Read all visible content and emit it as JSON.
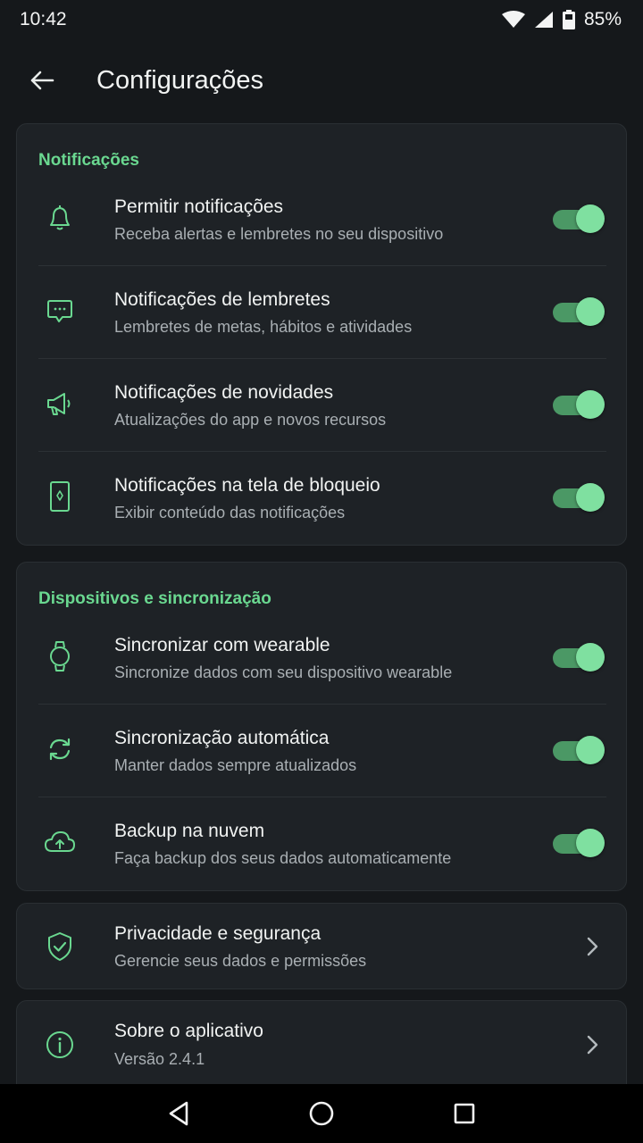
{
  "status": {
    "time": "10:42",
    "battery": "85%"
  },
  "header": {
    "title": "Configurações",
    "back_icon": "arrow-left-icon"
  },
  "colors": {
    "accent": "#6ad890",
    "background": "#15181b",
    "card": "#1e2226"
  },
  "notifications": {
    "title": "Notificações",
    "items": [
      {
        "title": "Permitir notificações",
        "subtitle": "Receba alertas e lembretes no seu dispositivo",
        "icon": "bell-icon",
        "enabled": true
      },
      {
        "title": "Notificações de lembretes",
        "subtitle": "Lembretes de metas, hábitos e atividades",
        "icon": "chat-bubble-icon",
        "enabled": true
      },
      {
        "title": "Notificações de novidades",
        "subtitle": "Atualizações do app e novos recursos",
        "icon": "megaphone-icon",
        "enabled": true
      },
      {
        "title": "Notificações na tela de bloqueio",
        "subtitle": "Exibir conteúdo das notificações",
        "icon": "phone-lock-icon",
        "enabled": true
      }
    ]
  },
  "devices": {
    "title": "Dispositivos e sincronização",
    "items": [
      {
        "title": "Sincronizar com wearable",
        "subtitle": "Sincronize dados com seu dispositivo wearable",
        "icon": "watch-icon",
        "enabled": true
      },
      {
        "title": "Sincronização automática",
        "subtitle": "Manter dados sempre atualizados",
        "icon": "sync-icon",
        "enabled": true
      },
      {
        "title": "Backup na nuvem",
        "subtitle": "Faça backup dos seus dados automaticamente",
        "icon": "cloud-upload-icon",
        "enabled": true
      }
    ]
  },
  "privacy": {
    "title": "Privacidade e segurança",
    "subtitle": "Gerencie seus dados e permissões",
    "icon": "shield-check-icon"
  },
  "about": {
    "title": "Sobre o aplicativo",
    "subtitle": "Versão 2.4.1",
    "icon": "info-icon"
  }
}
